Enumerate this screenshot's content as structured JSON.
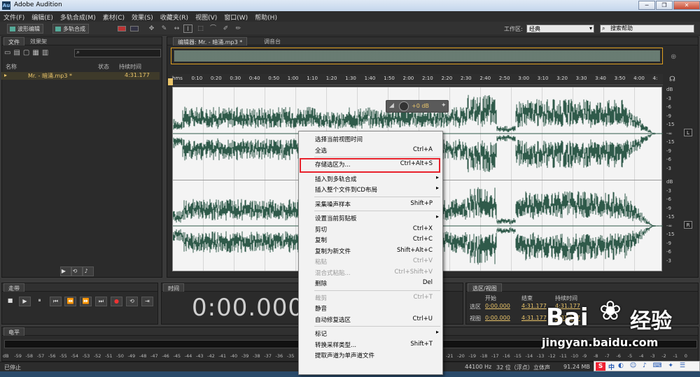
{
  "window": {
    "title": "Adobe Audition",
    "logo": "Au",
    "buttons": [
      "─",
      "❐",
      "✕"
    ]
  },
  "menu": [
    "文件(F)",
    "编辑(E)",
    "多轨合成(M)",
    "素材(C)",
    "效果(S)",
    "收藏夹(R)",
    "视图(V)",
    "窗口(W)",
    "帮助(H)"
  ],
  "toolbar": {
    "waveform_label": "波形编辑",
    "multitrack_label": "多轨合成",
    "workspace_label": "工作区:",
    "workspace_value": "经典",
    "search_placeholder": "搜索帮助"
  },
  "files_panel": {
    "tabs": [
      "文件",
      "效果架"
    ],
    "columns": {
      "name": "名称",
      "status": "状态",
      "duration": "持续时间"
    },
    "file": {
      "name": "Mr. - 暗涌.mp3 *",
      "duration": "4:31.177"
    }
  },
  "editor": {
    "tabs": [
      "编辑器: Mr. - 暗涌.mp3 *",
      "调音台"
    ],
    "ruler": [
      "hms",
      "0:10",
      "0:20",
      "0:30",
      "0:40",
      "0:50",
      "1:00",
      "1:10",
      "1:20",
      "1:30",
      "1:40",
      "1:50",
      "2:00",
      "2:10",
      "2:20",
      "2:30",
      "2:40",
      "2:50",
      "3:00",
      "3:10",
      "3:20",
      "3:30",
      "3:40",
      "3:50",
      "4:00",
      "4:"
    ],
    "gain": "+0 dB",
    "db_labels_top": [
      "dB",
      "-3",
      "-6",
      "-9",
      "-15",
      "-∞",
      "-15",
      "-9",
      "-6",
      "-3"
    ],
    "db_labels_bottom": [
      "dB",
      "-3",
      "-6",
      "-9",
      "-15",
      "-∞",
      "-15",
      "-9",
      "-6",
      "-3"
    ],
    "channel_left": "L",
    "channel_right": "R"
  },
  "context_menu": [
    {
      "label": "选择当前视图时间",
      "shortcut": ""
    },
    {
      "label": "全选",
      "shortcut": "Ctrl+A"
    },
    {
      "sep": true
    },
    {
      "label": "存储选区为...",
      "shortcut": "Ctrl+Alt+S",
      "highlight": true
    },
    {
      "sep": true
    },
    {
      "label": "插入到多轨合成",
      "shortcut": "",
      "submenu": true
    },
    {
      "label": "插入整个文件到CD布局",
      "shortcut": "",
      "submenu": true
    },
    {
      "sep": true
    },
    {
      "label": "采集噪声样本",
      "shortcut": "Shift+P"
    },
    {
      "sep": true
    },
    {
      "label": "设置当前剪贴板",
      "shortcut": "",
      "submenu": true
    },
    {
      "label": "剪切",
      "shortcut": "Ctrl+X"
    },
    {
      "label": "复制",
      "shortcut": "Ctrl+C"
    },
    {
      "label": "复制为新文件",
      "shortcut": "Shift+Alt+C"
    },
    {
      "label": "粘贴",
      "shortcut": "Ctrl+V",
      "disabled": true
    },
    {
      "label": "混合式粘贴...",
      "shortcut": "Ctrl+Shift+V",
      "disabled": true
    },
    {
      "label": "删除",
      "shortcut": "Del"
    },
    {
      "sep": true
    },
    {
      "label": "裁剪",
      "shortcut": "Ctrl+T",
      "disabled": true
    },
    {
      "label": "静音",
      "shortcut": ""
    },
    {
      "label": "自动修复选区",
      "shortcut": "Ctrl+U"
    },
    {
      "sep": true
    },
    {
      "label": "标记",
      "shortcut": "",
      "submenu": true
    },
    {
      "label": "转换采样类型...",
      "shortcut": "Shift+T"
    },
    {
      "label": "提取声道为单声道文件",
      "shortcut": ""
    }
  ],
  "transport": {
    "title": "走带"
  },
  "time_panel": {
    "title": "时间",
    "value": "0:00.000"
  },
  "selection_panel": {
    "title": "选区/视图",
    "headers": [
      "开始",
      "结束",
      "持续时间"
    ],
    "selection_label": "选区",
    "view_label": "视图",
    "selection": [
      "0:00.000",
      "4:31.177",
      "4:31.177"
    ],
    "view": [
      "0:00.000",
      "4:31.177",
      "4:31.177"
    ]
  },
  "levels": {
    "title": "电平",
    "scale": [
      "dB",
      "-59",
      "-58",
      "-57",
      "-56",
      "-55",
      "-54",
      "-53",
      "-52",
      "-51",
      "-50",
      "-49",
      "-48",
      "-47",
      "-46",
      "-45",
      "-44",
      "-43",
      "-42",
      "-41",
      "-40",
      "-39",
      "-38",
      "-37",
      "-36",
      "-35",
      "-34",
      "-33",
      "-32",
      "-31",
      "-30",
      "-29",
      "-28",
      "-27",
      "-26",
      "-25",
      "-24",
      "-23",
      "-22",
      "-21",
      "-20",
      "-19",
      "-18",
      "-17",
      "-16",
      "-15",
      "-14",
      "-13",
      "-12",
      "-11",
      "-10",
      "-9",
      "-8",
      "-7",
      "-6",
      "-5",
      "-4",
      "-3",
      "-2",
      "-1",
      "0"
    ]
  },
  "status": {
    "left": "已停止",
    "sample_rate": "44100 Hz",
    "bit_depth": "32 位（浮点）",
    "channels": "立体声",
    "size": "91.24 MB"
  },
  "ime": {
    "zh": "中"
  },
  "watermark": {
    "brand_a": "Bai",
    "brand_b": "经验",
    "url": "jingyan.baidu.com"
  },
  "colors": {
    "waveform": "#2f5a4a",
    "highlight": "#e8222c",
    "accent": "#e9c46a"
  }
}
